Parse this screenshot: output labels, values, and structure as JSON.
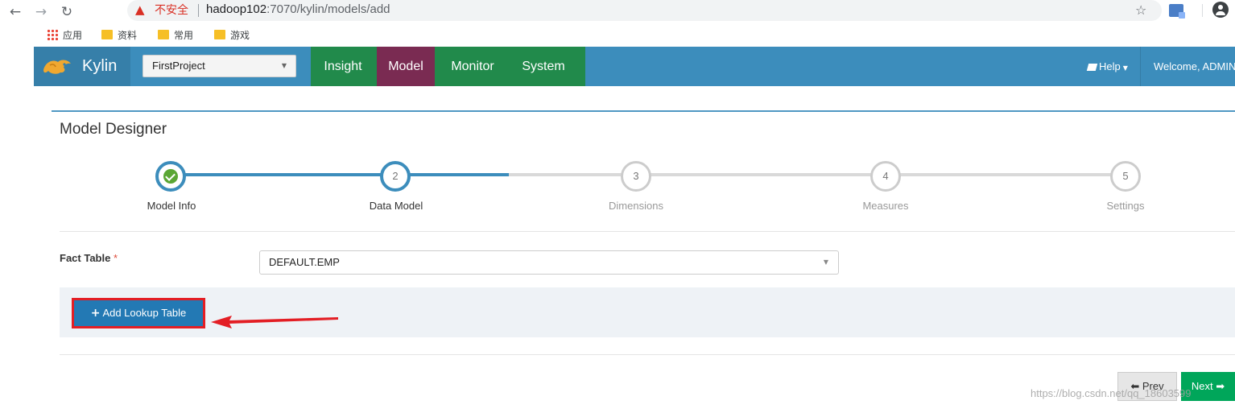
{
  "browser": {
    "warning_text": "不安全",
    "url_host": "hadoop102",
    "url_rest": ":7070/kylin/models/add",
    "bookmarks": [
      {
        "label": "应用"
      },
      {
        "label": "资料"
      },
      {
        "label": "常用"
      },
      {
        "label": "游戏"
      }
    ]
  },
  "header": {
    "brand": "Kylin",
    "project": "FirstProject",
    "menu": [
      {
        "label": "Insight",
        "active": false
      },
      {
        "label": "Model",
        "active": true
      },
      {
        "label": "Monitor",
        "active": false
      },
      {
        "label": "System",
        "active": false
      }
    ],
    "help": "Help",
    "welcome": "Welcome, ADMIN"
  },
  "page": {
    "title": "Model Designer"
  },
  "wizard": {
    "steps": [
      {
        "number": "1",
        "label": "Model Info",
        "state": "done"
      },
      {
        "number": "2",
        "label": "Data Model",
        "state": "current"
      },
      {
        "number": "3",
        "label": "Dimensions",
        "state": "todo"
      },
      {
        "number": "4",
        "label": "Measures",
        "state": "todo"
      },
      {
        "number": "5",
        "label": "Settings",
        "state": "todo"
      }
    ]
  },
  "form": {
    "fact_table_label": "Fact Table",
    "required_mark": "*",
    "fact_table_value": "DEFAULT.EMP",
    "add_lookup_label": "Add Lookup Table"
  },
  "footer": {
    "prev_label": "Prev",
    "next_label": "Next",
    "watermark": "https://blog.csdn.net/qq_18603599"
  },
  "colors": {
    "header_blue": "#3c8dbc",
    "menu_green": "#218a4b",
    "menu_active": "#7a2b52",
    "next_green": "#00a65a",
    "highlight_red": "#e31e24"
  }
}
